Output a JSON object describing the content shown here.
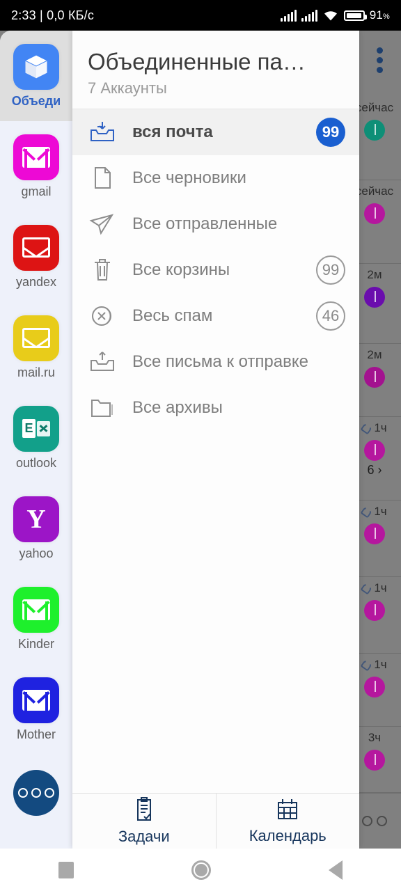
{
  "status_bar": {
    "time": "2:33",
    "separator": "|",
    "network_speed": "0,0 КБ/с",
    "battery_percent": "91",
    "percent_sign": "%",
    "icons": [
      "signal-icon",
      "signal-icon",
      "wifi-icon",
      "battery-icon"
    ]
  },
  "accounts_rail": {
    "items": [
      {
        "id": "unified",
        "label": "Объеди",
        "icon": "cube-icon",
        "color": "#4285f4",
        "selected": true
      },
      {
        "id": "gmail",
        "label": "gmail",
        "icon": "gmail-m-icon",
        "color": "#ed09d5",
        "selected": false
      },
      {
        "id": "yandex",
        "label": "yandex",
        "icon": "envelope-icon",
        "color": "#dd1414",
        "selected": false
      },
      {
        "id": "mailru",
        "label": "mail.ru",
        "icon": "envelope-icon",
        "color": "#e8cc1a",
        "selected": false
      },
      {
        "id": "outlook",
        "label": "outlook",
        "icon": "outlook-icon",
        "color": "#12a08a",
        "selected": false
      },
      {
        "id": "yahoo",
        "label": "yahoo",
        "icon": "yahoo-y-icon",
        "color": "#9c15c7",
        "selected": false
      },
      {
        "id": "kinder",
        "label": "Kinder",
        "icon": "gmail-m-icon",
        "color": "#1ef02c",
        "selected": false
      },
      {
        "id": "mother",
        "label": "Mother",
        "icon": "gmail-m-icon",
        "color": "#1f22e0",
        "selected": false
      }
    ],
    "more_button": {
      "label": "",
      "icon": "more-accounts-icon",
      "color": "#134a80"
    }
  },
  "drawer": {
    "title": "Объединенные па…",
    "subtitle": "7 Аккаунты",
    "folders": [
      {
        "label": "вся почта",
        "icon": "inbox-icon",
        "badge": "99",
        "badge_style": "filled",
        "active": true
      },
      {
        "label": "Все черновики",
        "icon": "draft-icon",
        "badge": "",
        "badge_style": "none",
        "active": false
      },
      {
        "label": "Все отправленные",
        "icon": "sent-icon",
        "badge": "",
        "badge_style": "none",
        "active": false
      },
      {
        "label": "Все корзины",
        "icon": "trash-icon",
        "badge": "99",
        "badge_style": "outline",
        "active": false
      },
      {
        "label": "Весь спам",
        "icon": "spam-icon",
        "badge": "46",
        "badge_style": "outline",
        "active": false
      },
      {
        "label": "Все письма к отправке",
        "icon": "outbox-icon",
        "badge": "",
        "badge_style": "none",
        "active": false
      },
      {
        "label": "Все архивы",
        "icon": "archive-icon",
        "badge": "",
        "badge_style": "none",
        "active": false
      }
    ],
    "bottom_bar": [
      {
        "label": "Задачи",
        "icon": "tasks-clipboard-icon"
      },
      {
        "label": "Календарь",
        "icon": "calendar-icon"
      }
    ]
  },
  "background_list": {
    "overflow_icon": "kebab-menu-icon",
    "rows": [
      {
        "time": "сейчас",
        "attachment": false,
        "avatar_color": "#0e8f77",
        "count": ""
      },
      {
        "time": "сейчас",
        "attachment": false,
        "avatar_color": "#b5179e",
        "count": ""
      },
      {
        "time": "2м",
        "attachment": false,
        "avatar_color": "#6a0dad",
        "count": ""
      },
      {
        "time": "2м",
        "attachment": false,
        "avatar_color": "#a3128f",
        "count": ""
      },
      {
        "time": "1ч",
        "attachment": true,
        "avatar_color": "#b5179e",
        "count": "6 ›"
      },
      {
        "time": "1ч",
        "attachment": true,
        "avatar_color": "#b5179e",
        "count": ""
      },
      {
        "time": "1ч",
        "attachment": true,
        "avatar_color": "#b5179e",
        "count": ""
      },
      {
        "time": "1ч",
        "attachment": true,
        "avatar_color": "#b5179e",
        "count": ""
      },
      {
        "time": "3ч",
        "attachment": false,
        "avatar_color": "#b5179e",
        "count": ""
      }
    ]
  },
  "nav_bar": {
    "items": [
      {
        "icon": "recents-square-icon"
      },
      {
        "icon": "home-circle-icon"
      },
      {
        "icon": "back-triangle-icon"
      }
    ]
  },
  "colors": {
    "accent_blue": "#1a5fd0",
    "drawer_bg": "#fdfdfd",
    "rail_bg": "#eef1fa",
    "dim_bg": "#808080",
    "navy": "#16355c"
  }
}
